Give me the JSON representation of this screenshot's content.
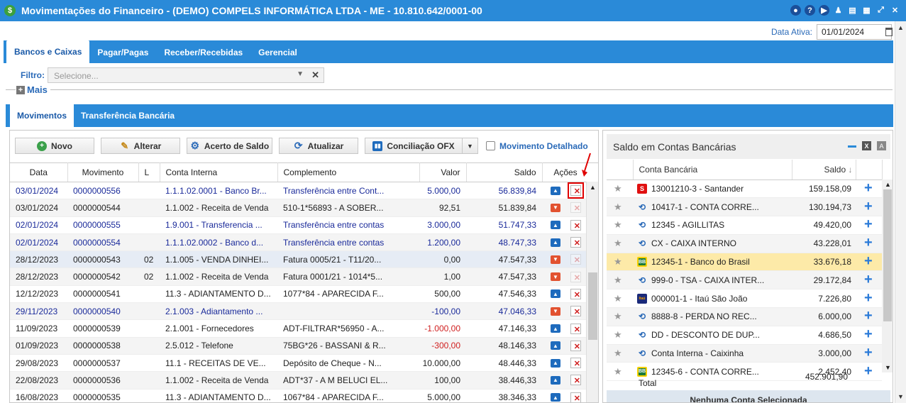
{
  "window": {
    "title": "Movimentações do Financeiro - (DEMO) COMPELS INFORMÁTICA LTDA - ME - 10.810.642/0001-00",
    "app_icon": "$"
  },
  "data_ativa": {
    "label": "Data Ativa:",
    "value": "01/01/2024"
  },
  "main_tabs": [
    {
      "label": "Bancos e Caixas"
    },
    {
      "label": "Pagar/Pagas"
    },
    {
      "label": "Receber/Recebidas"
    },
    {
      "label": "Gerencial"
    }
  ],
  "filtro": {
    "label": "Filtro:",
    "placeholder": "Selecione..."
  },
  "mais": {
    "label": "Mais"
  },
  "sub_tabs": [
    {
      "label": "Movimentos"
    },
    {
      "label": "Transferência Bancária"
    }
  ],
  "toolbar": {
    "novo": "Novo",
    "alterar": "Alterar",
    "acerto": "Acerto de Saldo",
    "atualizar": "Atualizar",
    "conciliacao": "Conciliação OFX",
    "detalhado": "Movimento Detalhado"
  },
  "movimentos": {
    "columns": [
      "Data",
      "Movimento",
      "L",
      "Conta Interna",
      "Complemento",
      "Valor",
      "Saldo",
      "Ações"
    ],
    "rows": [
      {
        "data": "03/01/2024",
        "mov": "0000000556",
        "l": "",
        "conta": "1.1.1.02.0001 - Banco Br...",
        "comp": "Transferência entre Cont...",
        "valor": "5.000,00",
        "saldo": "56.839,84",
        "blue": true,
        "action": "like",
        "cancel": "active"
      },
      {
        "data": "03/01/2024",
        "mov": "0000000544",
        "l": "",
        "conta": "1.1.002 - Receita de Venda",
        "comp": "510-1*56893 - A SOBER...",
        "valor": "92,51",
        "saldo": "51.839,84",
        "blue": false,
        "action": "dislike",
        "cancel": "dim"
      },
      {
        "data": "02/01/2024",
        "mov": "0000000555",
        "l": "",
        "conta": "1.9.001 - Transferencia ...",
        "comp": "Transferência entre contas",
        "valor": "3.000,00",
        "saldo": "51.747,33",
        "blue": true,
        "action": "like",
        "cancel": "active"
      },
      {
        "data": "02/01/2024",
        "mov": "0000000554",
        "l": "",
        "conta": "1.1.1.02.0002 - Banco d...",
        "comp": "Transferência entre contas",
        "valor": "1.200,00",
        "saldo": "48.747,33",
        "blue": true,
        "action": "like",
        "cancel": "active"
      },
      {
        "data": "28/12/2023",
        "mov": "0000000543",
        "l": "02",
        "conta": "1.1.005 - VENDA DINHEI...",
        "comp": "Fatura 0005/21 - T11/20...",
        "valor": "0,00",
        "saldo": "47.547,33",
        "blue": false,
        "action": "dislike",
        "cancel": "dim"
      },
      {
        "data": "28/12/2023",
        "mov": "0000000542",
        "l": "02",
        "conta": "1.1.002 - Receita de Venda",
        "comp": "Fatura 0001/21 - 1014*5...",
        "valor": "1,00",
        "saldo": "47.547,33",
        "blue": false,
        "action": "dislike",
        "cancel": "dim"
      },
      {
        "data": "12/12/2023",
        "mov": "0000000541",
        "l": "",
        "conta": "11.3 - ADIANTAMENTO D...",
        "comp": "1077*84 - APARECIDA F...",
        "valor": "500,00",
        "saldo": "47.546,33",
        "blue": false,
        "action": "like",
        "cancel": "active"
      },
      {
        "data": "29/11/2023",
        "mov": "0000000540",
        "l": "",
        "conta": "2.1.003 - Adiantamento ...",
        "comp": "",
        "valor": "-100,00",
        "saldo": "47.046,33",
        "blue": true,
        "action": "dislike",
        "cancel": "active"
      },
      {
        "data": "11/09/2023",
        "mov": "0000000539",
        "l": "",
        "conta": "2.1.001 - Fornecedores",
        "comp": "ADT-FILTRAR*56950 - A...",
        "valor": "-1.000,00",
        "saldo": "47.146,33",
        "blue": false,
        "action": "like",
        "cancel": "active"
      },
      {
        "data": "01/09/2023",
        "mov": "0000000538",
        "l": "",
        "conta": "2.5.012 - Telefone",
        "comp": "75BG*26 - BASSANI & R...",
        "valor": "-300,00",
        "saldo": "48.146,33",
        "blue": false,
        "action": "like",
        "cancel": "active"
      },
      {
        "data": "29/08/2023",
        "mov": "0000000537",
        "l": "",
        "conta": "11.1 - RECEITAS DE VE...",
        "comp": "Depósito de Cheque - N...",
        "valor": "10.000,00",
        "saldo": "48.446,33",
        "blue": false,
        "action": "like",
        "cancel": "active"
      },
      {
        "data": "22/08/2023",
        "mov": "0000000536",
        "l": "",
        "conta": "1.1.002 - Receita de Venda",
        "comp": "ADT*37 - A M BELUCI EL...",
        "valor": "100,00",
        "saldo": "38.446,33",
        "blue": false,
        "action": "like",
        "cancel": "active"
      },
      {
        "data": "16/08/2023",
        "mov": "0000000535",
        "l": "",
        "conta": "11.3 - ADIANTAMENTO D...",
        "comp": "1067*84 - APARECIDA F...",
        "valor": "5.000,00",
        "saldo": "38.346,33",
        "blue": false,
        "action": "like",
        "cancel": "active"
      }
    ]
  },
  "saldo_panel": {
    "title": "Saldo em Contas Bancárias",
    "columns": [
      "Conta Bancária",
      "Saldo"
    ],
    "rows": [
      {
        "conta": "13001210-3 - Santander",
        "saldo": "159.158,09",
        "bank": "santander"
      },
      {
        "conta": "10417-1 - CONTA CORRE...",
        "saldo": "130.194,73",
        "bank": "generic"
      },
      {
        "conta": "12345 - AGILLITAS",
        "saldo": "49.420,00",
        "bank": "generic"
      },
      {
        "conta": "CX - CAIXA INTERNO",
        "saldo": "43.228,01",
        "bank": "generic"
      },
      {
        "conta": "12345-1 - Banco do Brasil",
        "saldo": "33.676,18",
        "bank": "bb"
      },
      {
        "conta": "999-0 - TSA - CAIXA INTER...",
        "saldo": "29.172,84",
        "bank": "generic"
      },
      {
        "conta": "000001-1 - Itaú São João",
        "saldo": "7.226,80",
        "bank": "itau"
      },
      {
        "conta": "8888-8 - PERDA NO REC...",
        "saldo": "6.000,00",
        "bank": "generic"
      },
      {
        "conta": "DD - DESCONTO DE DUP...",
        "saldo": "4.686,50",
        "bank": "generic"
      },
      {
        "conta": "Conta Interna - Caixinha",
        "saldo": "3.000,00",
        "bank": "generic"
      },
      {
        "conta": "12345-6 - CONTA CORRE...",
        "saldo": "2.452,40",
        "bank": "bb"
      }
    ],
    "total_label": "Total",
    "total_value": "452.901,90",
    "nenhuma": "Nenhuma Conta Selecionada"
  }
}
